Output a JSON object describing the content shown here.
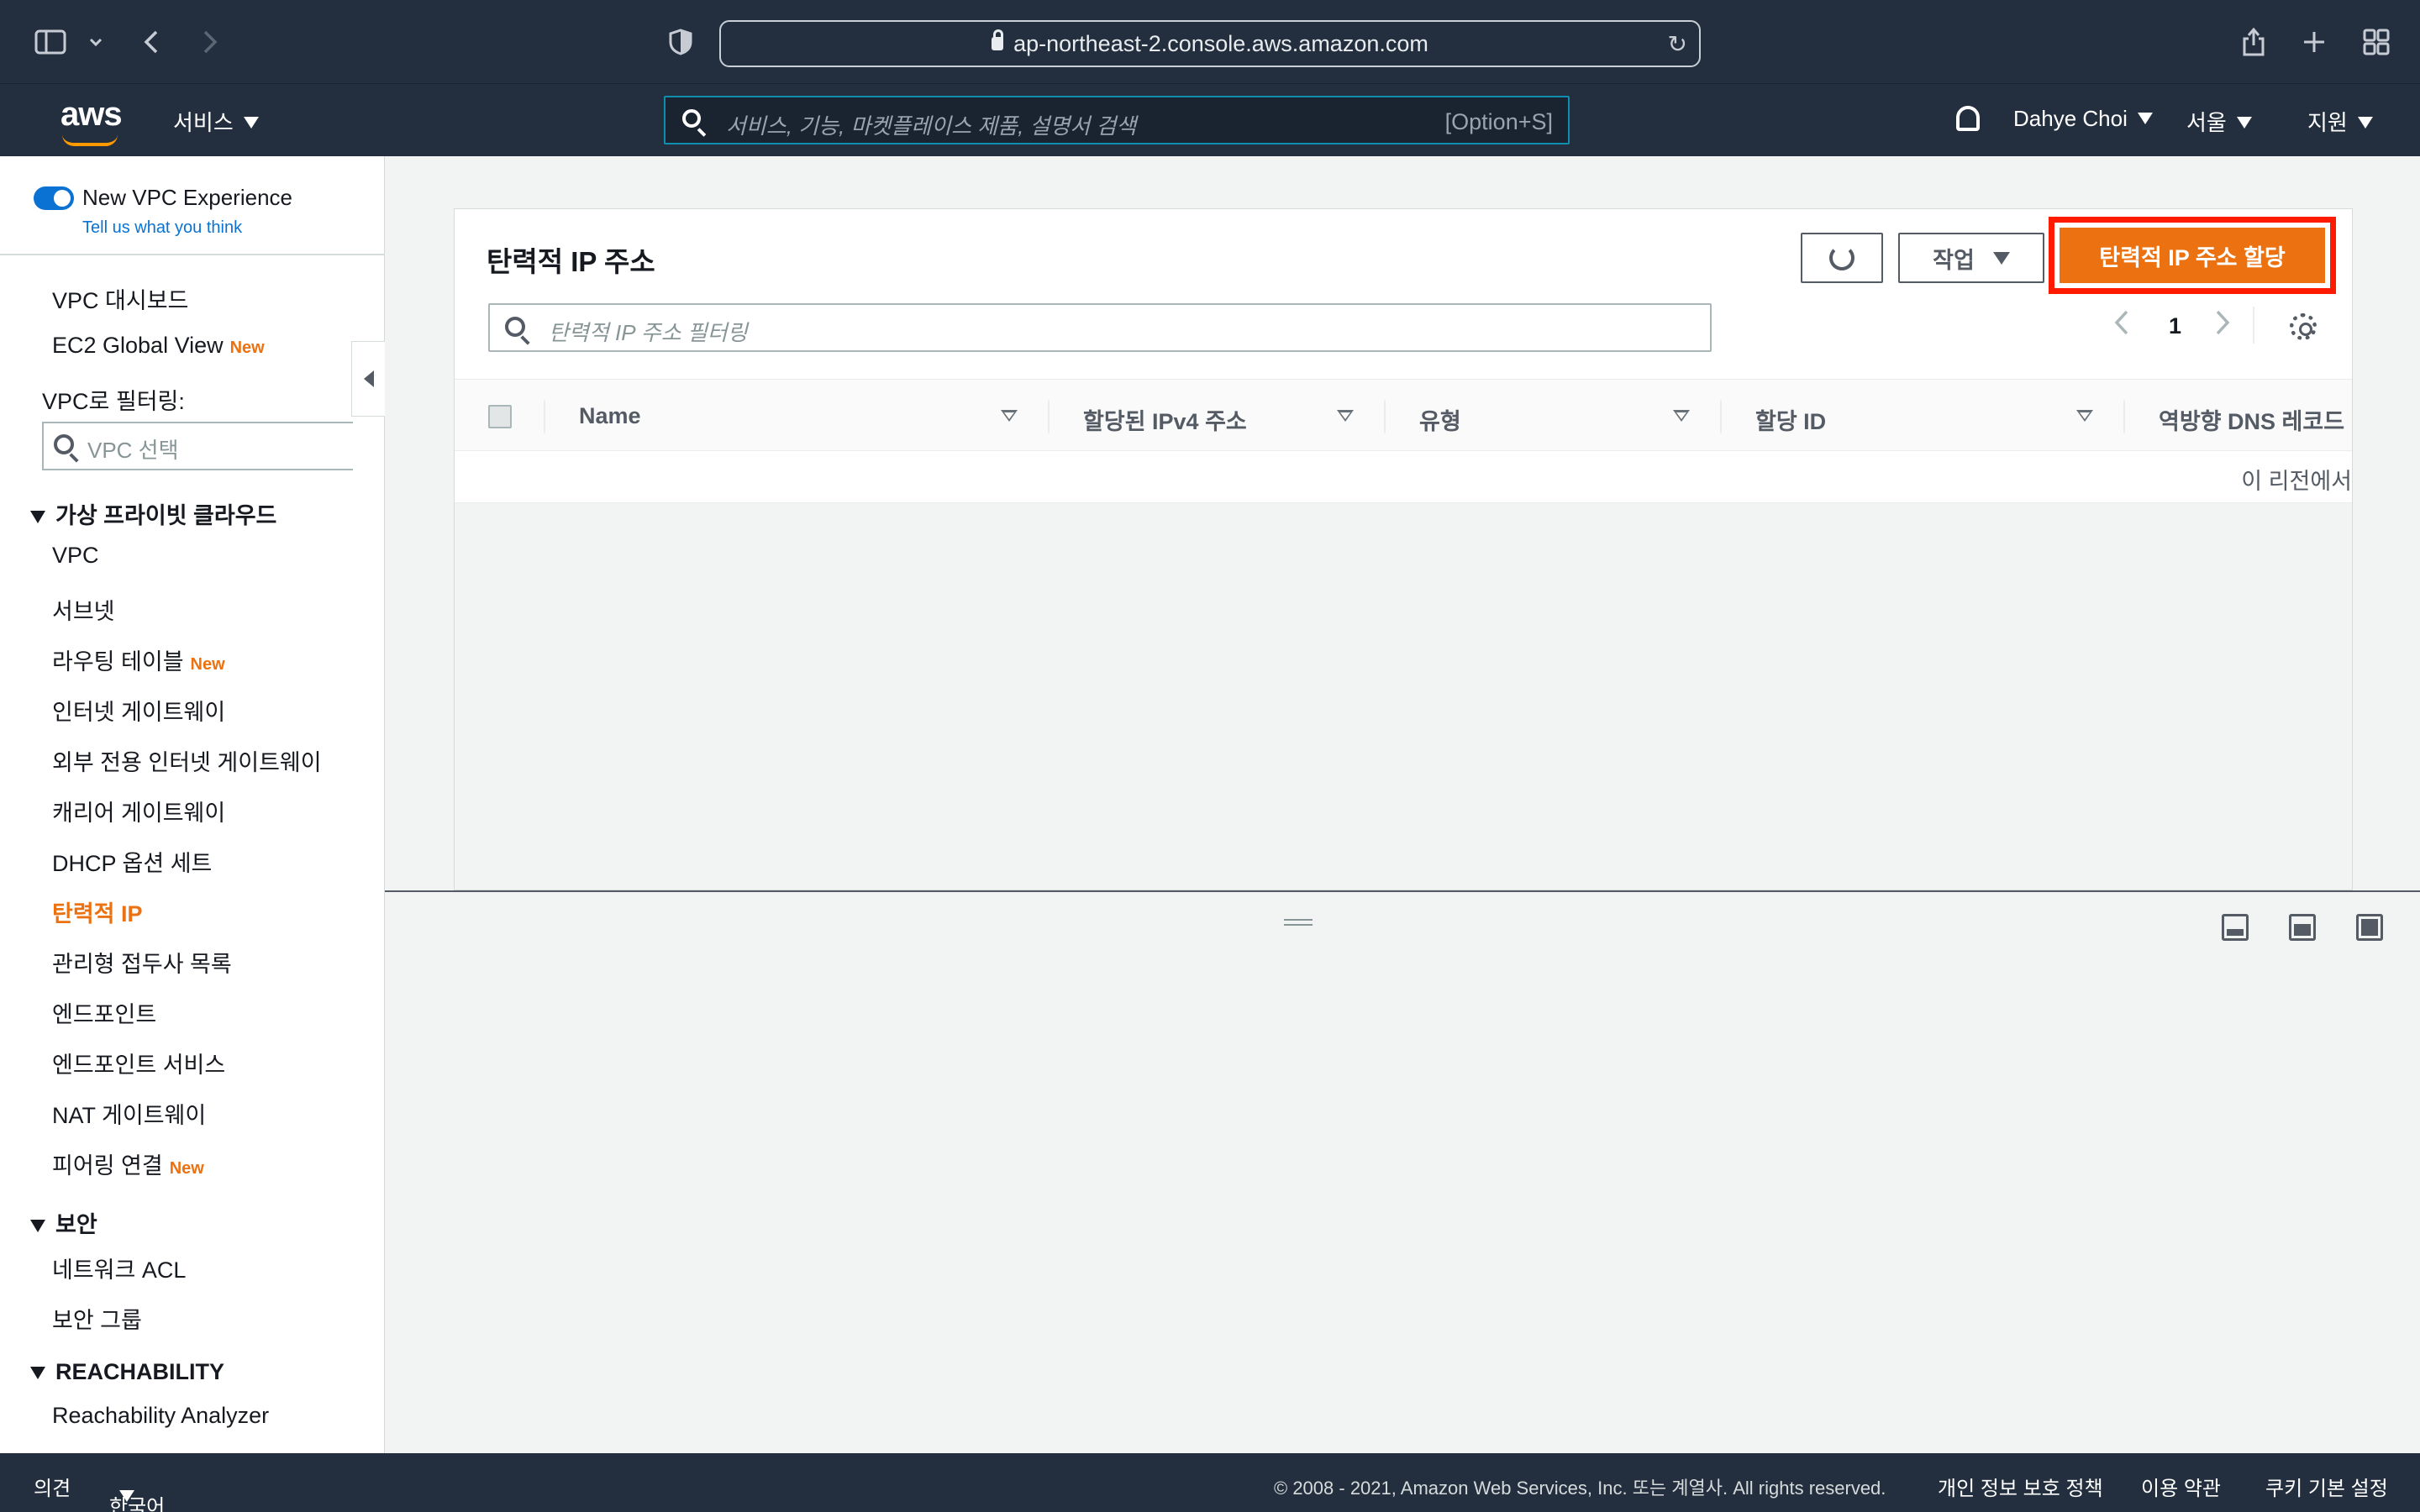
{
  "browser": {
    "url": "ap-northeast-2.console.aws.amazon.com",
    "icons": [
      "sidebar-icon",
      "chevron-down-icon",
      "back-icon",
      "forward-icon",
      "shield-icon",
      "lock-icon",
      "reload-icon",
      "share-icon",
      "new-tab-icon",
      "tab-overview-icon"
    ]
  },
  "header": {
    "logo": "aws",
    "services": "서비스",
    "search_placeholder": "서비스, 기능, 마켓플레이스 제품, 설명서 검색",
    "search_shortcut": "[Option+S]",
    "user": "Dahye Choi",
    "region": "서울",
    "support": "지원"
  },
  "sidebar": {
    "experience_label": "New VPC Experience",
    "feedback_link": "Tell us what you think",
    "dashboard": "VPC 대시보드",
    "ec2_global": "EC2 Global View",
    "new_badge": "New",
    "filter_label": "VPC로 필터링:",
    "filter_placeholder": "VPC 선택",
    "sections": [
      {
        "title": "가상 프라이빗 클라우드",
        "items": [
          {
            "label": "VPC",
            "new": false
          },
          {
            "label": "서브넷",
            "new": false
          },
          {
            "label": "라우팅 테이블",
            "new": true
          },
          {
            "label": "인터넷 게이트웨이",
            "new": false
          },
          {
            "label": "외부 전용 인터넷 게이트웨이",
            "new": false
          },
          {
            "label": "캐리어 게이트웨이",
            "new": false
          },
          {
            "label": "DHCP 옵션 세트",
            "new": false
          },
          {
            "label": "탄력적 IP",
            "new": false,
            "active": true
          },
          {
            "label": "관리형 접두사 목록",
            "new": false
          },
          {
            "label": "엔드포인트",
            "new": false
          },
          {
            "label": "엔드포인트 서비스",
            "new": false
          },
          {
            "label": "NAT 게이트웨이",
            "new": false
          },
          {
            "label": "피어링 연결",
            "new": true
          }
        ]
      },
      {
        "title": "보안",
        "items": [
          {
            "label": "네트워크 ACL"
          },
          {
            "label": "보안 그룹"
          }
        ]
      },
      {
        "title": "REACHABILITY",
        "items": [
          {
            "label": "Reachability Analyzer"
          }
        ]
      }
    ]
  },
  "main": {
    "title": "탄력적 IP 주소",
    "actions_label": "작업",
    "allocate_label": "탄력적 IP 주소 할당",
    "filter_placeholder": "탄력적 IP 주소 필터링",
    "page": "1",
    "columns": [
      "Name",
      "할당된 IPv4 주소",
      "유형",
      "할당 ID",
      "역방향 DNS 레코드"
    ],
    "empty_text": "이 리전에서"
  },
  "footer": {
    "feedback": "의견",
    "language": "한국어",
    "copyright": "© 2008 - 2021, Amazon Web Services, Inc. 또는 계열사. All rights reserved.",
    "privacy": "개인 정보 보호 정책",
    "terms": "이용 약관",
    "cookies": "쿠키 기본 설정"
  },
  "colors": {
    "accent": "#ec7211",
    "header": "#232f3e",
    "highlight": "#ff1a00",
    "link": "#0972d3"
  }
}
